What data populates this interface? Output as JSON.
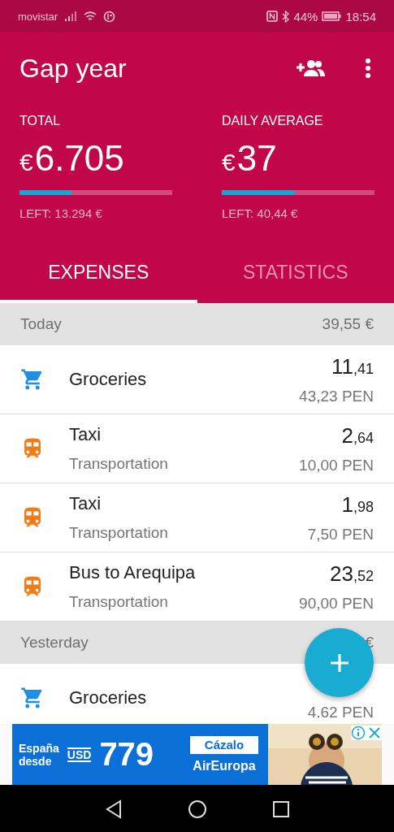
{
  "status_bar": {
    "carrier": "movistar",
    "battery": "44%",
    "time": "18:54"
  },
  "app_bar": {
    "title": "Gap year"
  },
  "stats": [
    {
      "label": "TOTAL",
      "currency": "€",
      "value": "6.705",
      "level": 0.34,
      "left": "LEFT: 13.294 €"
    },
    {
      "label": "DAILY AVERAGE",
      "currency": "€",
      "value": "37",
      "level": 0.48,
      "left": "LEFT: 40,44 €"
    }
  ],
  "tabs": [
    {
      "label": "EXPENSES",
      "selected": true
    },
    {
      "label": "STATISTICS",
      "selected": false
    }
  ],
  "sections": [
    {
      "title": "Today",
      "total": "39,55 €",
      "items": [
        {
          "kind": "cart",
          "name": "Groceries",
          "amount": "11,41",
          "original": "43,23 PEN"
        },
        {
          "kind": "train",
          "name": "Taxi",
          "category": "Transportation",
          "amount": "2,64",
          "original": "10,00 PEN"
        },
        {
          "kind": "train",
          "name": "Taxi",
          "category": "Transportation",
          "amount": "1,98",
          "original": "7,50 PEN"
        },
        {
          "kind": "train",
          "name": "Bus to Arequipa",
          "category": "Transportation",
          "amount": "23,52",
          "original": "90,00 PEN"
        }
      ]
    },
    {
      "title": "Yesterday",
      "total": "€",
      "items": [
        {
          "kind": "cart",
          "name": "Groceries",
          "original": "4.62 PEN"
        }
      ]
    }
  ],
  "ad": {
    "line_1": "España",
    "line_2": "desde",
    "currency": "USD",
    "price": "779",
    "cta": "Cázalo",
    "brand": "AirEuropa"
  }
}
